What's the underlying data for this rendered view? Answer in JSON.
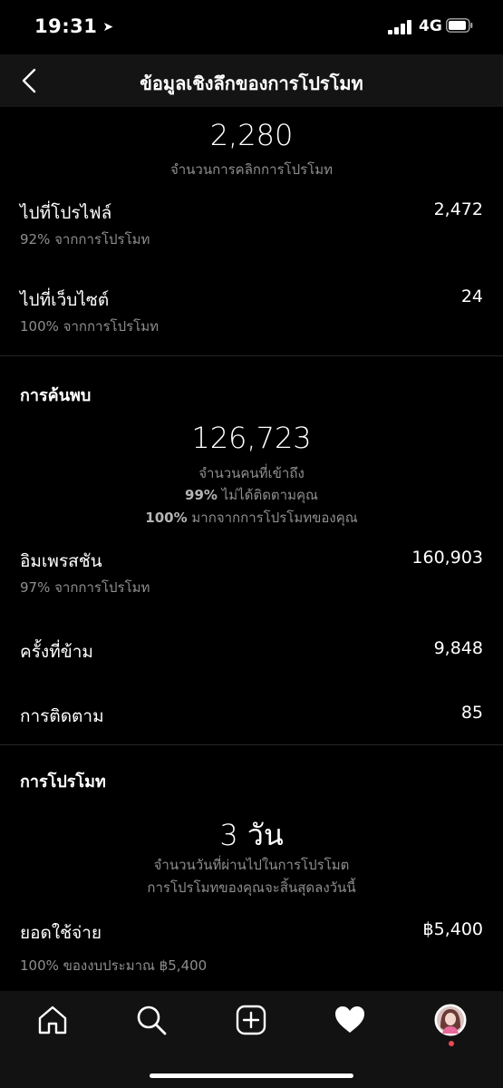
{
  "status": {
    "time": "19:31",
    "network": "4G"
  },
  "header": {
    "title": "ข้อมูลเชิงลึกของการโปรโมท"
  },
  "clicks": {
    "total": "2,280",
    "total_label": "จำนวนการคลิกการโปรโมท",
    "rows": [
      {
        "label": "ไปที่โปรไฟล์",
        "value": "2,472",
        "sub": "92% จากการโปรโมท"
      },
      {
        "label": "ไปที่เว็บไซต์",
        "value": "24",
        "sub": "100% จากการโปรโมท"
      }
    ]
  },
  "discovery": {
    "title": "การค้นพบ",
    "reach": "126,723",
    "reach_label": "จำนวนคนที่เข้าถึง",
    "pct_not_following": "99%",
    "not_following_text": "ไม่ได้ติดตามคุณ",
    "pct_from_promo": "100%",
    "from_promo_text": "มากจากการโปรโมทของคุณ",
    "impressions_label": "อิมเพรสชัน",
    "impressions_value": "160,903",
    "impressions_sub": "97% จากการโปรโมท",
    "skips_label": "ครั้งที่ข้าม",
    "skips_value": "9,848",
    "follows_label": "การติดตาม",
    "follows_value": "85"
  },
  "promotion": {
    "title": "การโปรโมท",
    "duration": "3 วัน",
    "duration_label": "จำนวนวันที่ผ่านไปในการโปรโมต",
    "ends_text": "การโปรโมทของคุณจะสิ้นสุดลงวันนี้",
    "spend_label": "ยอดใช้จ่าย",
    "spend_value": "฿5,400",
    "spend_sub": "100% ของงบประมาณ ฿5,400"
  },
  "tabs": [
    "home-icon",
    "search-icon",
    "add-post-icon",
    "activity-heart-icon",
    "profile-avatar"
  ],
  "colors": {
    "background": "#000000",
    "nav": "#141414",
    "secondary_text": "#8e8e8e",
    "notification_dot": "#ed4956"
  }
}
